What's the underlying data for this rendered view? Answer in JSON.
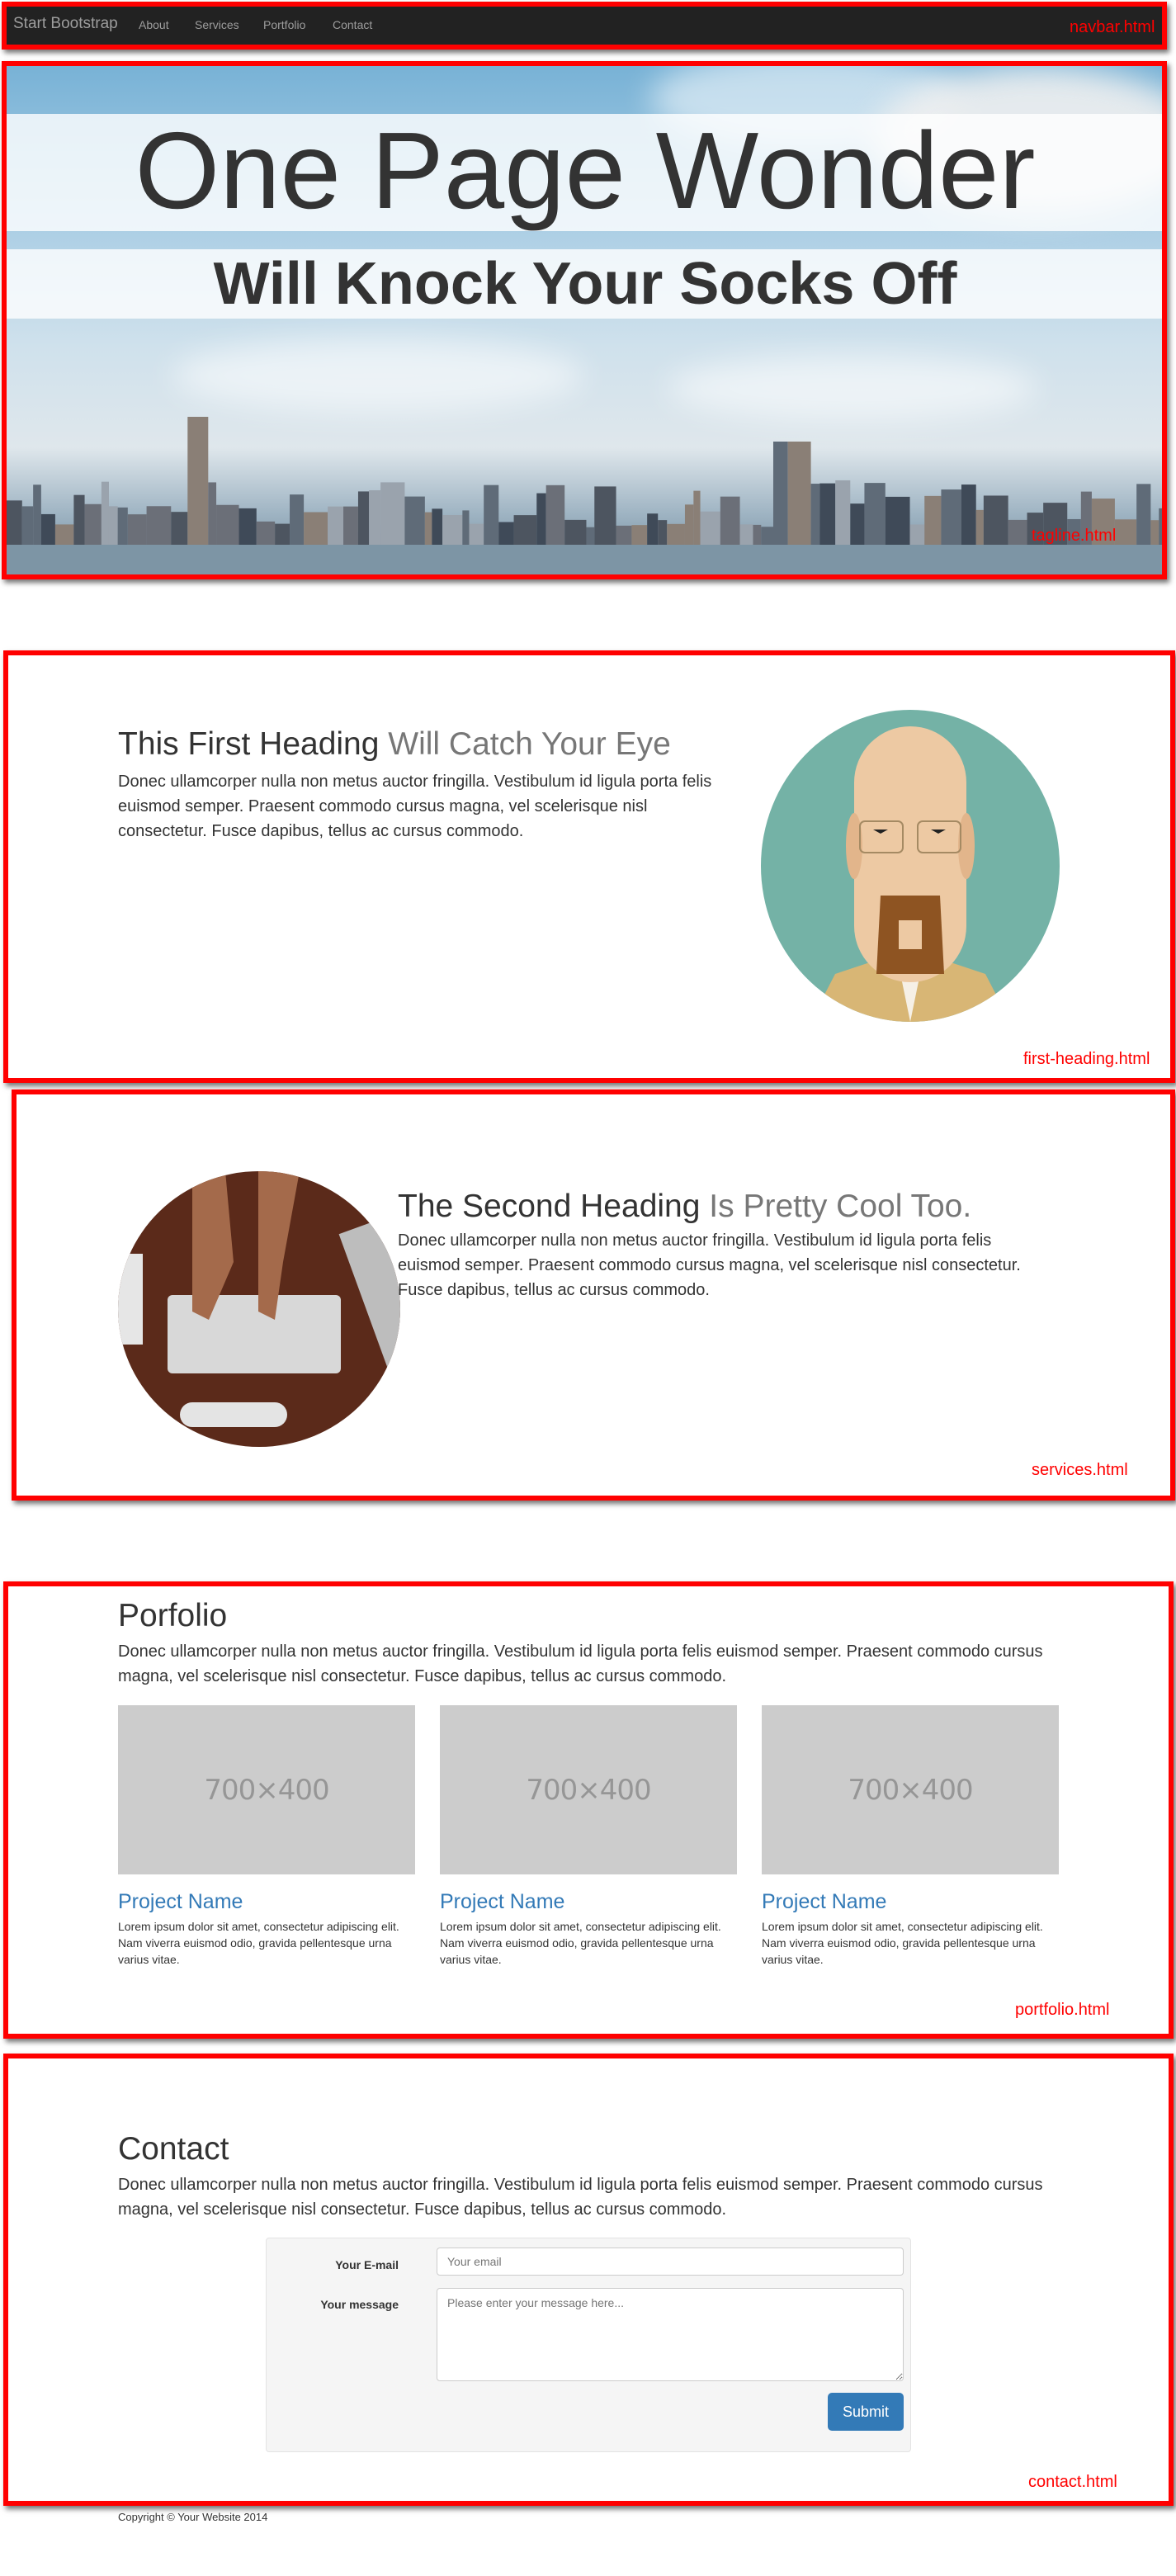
{
  "navbar": {
    "brand": "Start Bootstrap",
    "links": [
      "About",
      "Services",
      "Portfolio",
      "Contact"
    ],
    "bg_color": "#222222"
  },
  "hero": {
    "title": "One Page Wonder",
    "subtitle": "Will Knock Your Socks Off"
  },
  "first_section": {
    "heading_main": "This First Heading",
    "heading_muted": "Will Catch Your Eye",
    "text": "Donec ullamcorper nulla non metus auctor fringilla. Vestibulum id ligula porta felis euismod semper. Praesent commodo cursus magna, vel scelerisque nisl consectetur. Fusce dapibus, tellus ac cursus commodo."
  },
  "second_section": {
    "heading_main": "The Second Heading",
    "heading_muted": "Is Pretty Cool Too.",
    "text": "Donec ullamcorper nulla non metus auctor fringilla. Vestibulum id ligula porta felis euismod semper. Praesent commodo cursus magna, vel scelerisque nisl consectetur. Fusce dapibus, tellus ac cursus commodo."
  },
  "portfolio": {
    "heading": "Porfolio",
    "text": "Donec ullamcorper nulla non metus auctor fringilla. Vestibulum id ligula porta felis euismod semper. Praesent commodo cursus magna, vel scelerisque nisl consectetur. Fusce dapibus, tellus ac cursus commodo.",
    "projects": [
      {
        "image_label": "700×400",
        "name": "Project Name",
        "desc": "Lorem ipsum dolor sit amet, consectetur adipiscing elit. Nam viverra euismod odio, gravida pellentesque urna varius vitae."
      },
      {
        "image_label": "700×400",
        "name": "Project Name",
        "desc": "Lorem ipsum dolor sit amet, consectetur adipiscing elit. Nam viverra euismod odio, gravida pellentesque urna varius vitae."
      },
      {
        "image_label": "700×400",
        "name": "Project Name",
        "desc": "Lorem ipsum dolor sit amet, consectetur adipiscing elit. Nam viverra euismod odio, gravida pellentesque urna varius vitae."
      }
    ],
    "link_color": "#337ab7"
  },
  "contact": {
    "heading": "Contact",
    "text": "Donec ullamcorper nulla non metus auctor fringilla. Vestibulum id ligula porta felis euismod semper. Praesent commodo cursus magna, vel scelerisque nisl consectetur. Fusce dapibus, tellus ac cursus commodo.",
    "email_label": "Your E-mail",
    "email_placeholder": "Your email",
    "message_label": "Your message",
    "message_placeholder": "Please enter your message here...",
    "submit_label": "Submit",
    "button_color": "#337ab7"
  },
  "footer": {
    "copyright": "Copyright © Your Website 2014"
  },
  "annotations": {
    "color": "#ff0000",
    "labels": [
      "navbar.html",
      "tagline.html",
      "first-heading.html",
      "services.html",
      "portfolio.html",
      "contact.html"
    ]
  }
}
